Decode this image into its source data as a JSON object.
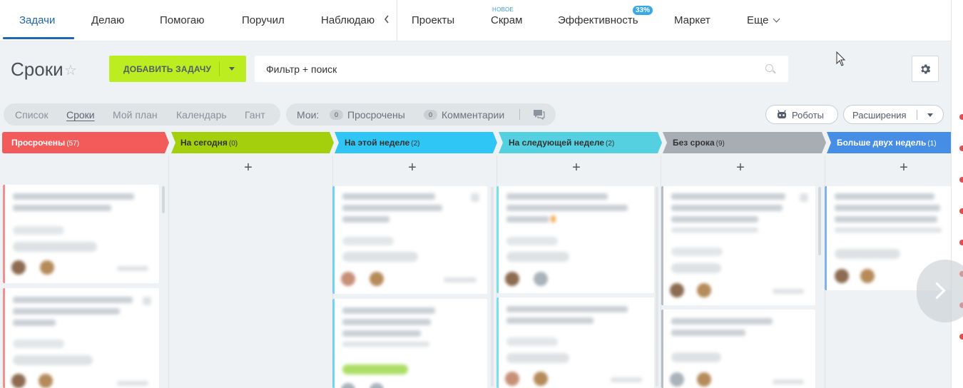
{
  "nav": {
    "items": [
      {
        "label": "Задачи",
        "active": true
      },
      {
        "label": "Делаю"
      },
      {
        "label": "Помогаю"
      },
      {
        "label": "Поручил"
      },
      {
        "label": "Наблюдаю"
      },
      {
        "label": "Проекты"
      },
      {
        "label": "Скрам",
        "badge": "НОВОЕ"
      },
      {
        "label": "Эффективность",
        "badge": "33%"
      },
      {
        "label": "Маркет"
      },
      {
        "label": "Еще"
      }
    ],
    "collapse_icon": "chevron-left-icon"
  },
  "page": {
    "title": "Сроки",
    "add_task": "ДОБАВИТЬ ЗАДАЧУ",
    "search_value": "Фильтр + поиск"
  },
  "views": [
    "Список",
    "Сроки",
    "Мой план",
    "Календарь",
    "Гант"
  ],
  "active_view": "Сроки",
  "counters": {
    "label": "Мои:",
    "overdue_count": "0",
    "overdue_label": "Просрочены",
    "comments_count": "0",
    "comments_label": "Комментарии"
  },
  "buttons": {
    "robots": "Роботы",
    "extensions": "Расширения"
  },
  "columns": [
    {
      "title": "Просрочены",
      "count": "(57)",
      "color": "#f35b5b",
      "text_color": "#ffffff"
    },
    {
      "title": "На сегодня",
      "count": "(0)",
      "color": "#a3cf0d",
      "text_color": "#333333"
    },
    {
      "title": "На этой неделе",
      "count": "(2)",
      "color": "#2fc6f6",
      "text_color": "#333333"
    },
    {
      "title": "На следующей неделе",
      "count": "(2)",
      "color": "#55d0e0",
      "text_color": "#333333"
    },
    {
      "title": "Без срока",
      "count": "(9)",
      "color": "#a8adb4",
      "text_color": "#333333"
    },
    {
      "title": "Больше двух недель",
      "count": "(1)",
      "color": "#468ee5",
      "text_color": "#ffffff"
    }
  ],
  "add_symbol": "+",
  "colors": {
    "accent": "#2066b0",
    "add_button": "#bbed21"
  }
}
